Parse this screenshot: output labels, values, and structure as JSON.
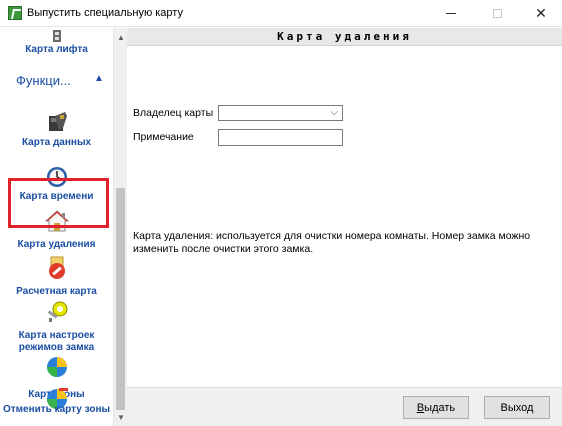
{
  "window": {
    "title": "Выпустить специальную карту",
    "min_glyph": "—",
    "close_glyph": "✕"
  },
  "sidebar": {
    "group_header": "Функци...",
    "group_caret": "▲",
    "items": [
      {
        "label": "Карта лифта",
        "icon": "elevator-icon"
      },
      {
        "label": "Карта данных",
        "icon": "data-card-icon"
      },
      {
        "label": "Карта времени",
        "icon": "clock-icon"
      },
      {
        "label": "Карта удаления",
        "icon": "home-icon",
        "selected": true
      },
      {
        "label": "Расчетная карта",
        "icon": "no-entry-icon"
      },
      {
        "label": "Карта настроек режимов замка",
        "label_line1": "Карта настроек",
        "label_line2": "режимов замка",
        "icon": "key-settings-icon"
      },
      {
        "label": "Карта зоны",
        "icon": "zone-icon"
      },
      {
        "label": "Отменить карту зоны",
        "icon": "cancel-zone-icon"
      }
    ],
    "scroll_up": "▲",
    "scroll_down": "▼"
  },
  "main": {
    "header": "Карта удаления",
    "owner_label": "Владелец карты",
    "owner_value": "",
    "note_label": "Примечание",
    "note_value": "",
    "description": "Карта удаления: используется для очистки номера комнаты. Номер замка можно изменить после очистки этого замка.",
    "issue_label": "Выдать",
    "issue_label_first": "В",
    "issue_label_rest": "ыдать",
    "exit_label": "Выход"
  },
  "colors": {
    "accent": "#1a4fa3",
    "selection_border": "#e0202a",
    "header_bg": "#e8e8e8"
  }
}
